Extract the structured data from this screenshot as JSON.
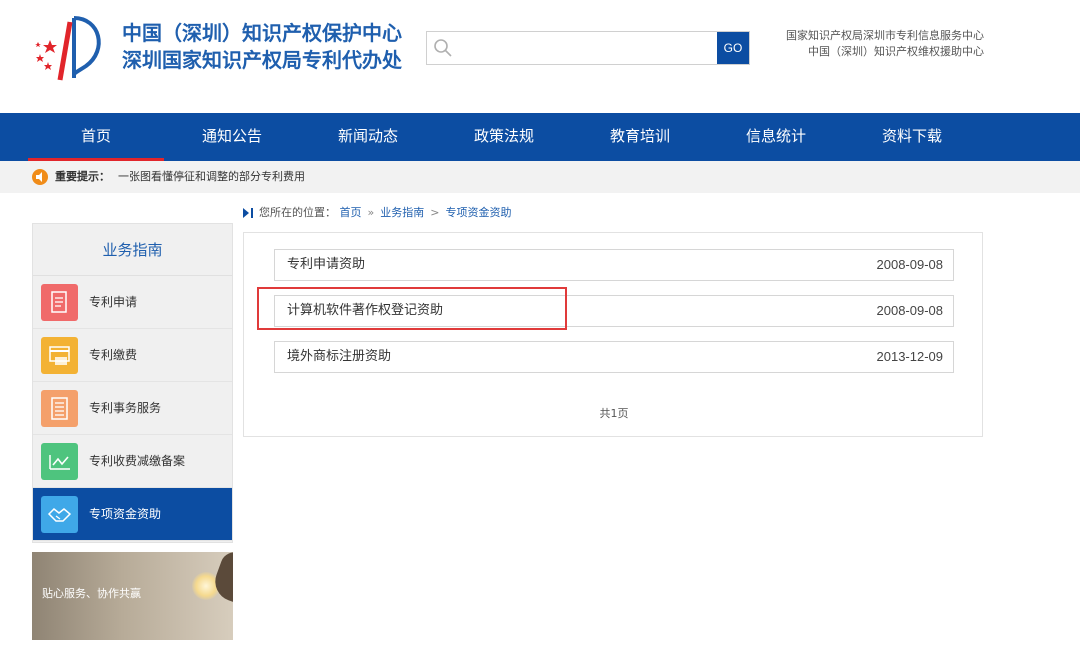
{
  "header": {
    "org_name_line1": "中国（深圳）知识产权保护中心",
    "org_name_line2": "深圳国家知识产权局专利代办处",
    "search": {
      "placeholder": "",
      "go_label": "GO"
    },
    "info_line1": "国家知识产权局深圳市专利信息服务中心",
    "info_line2": "中国（深圳）知识产权维权援助中心"
  },
  "nav": {
    "items": [
      {
        "label": "首页"
      },
      {
        "label": "通知公告"
      },
      {
        "label": "新闻动态"
      },
      {
        "label": "政策法规"
      },
      {
        "label": "教育培训"
      },
      {
        "label": "信息统计"
      },
      {
        "label": "资料下载"
      }
    ]
  },
  "notice": {
    "label": "重要提示：",
    "text": "一张图看懂停征和调整的部分专利费用"
  },
  "breadcrumb": {
    "prefix": "您所在的位置：",
    "items": [
      "首页",
      "业务指南",
      "专项资金资助"
    ],
    "sep1": "»",
    "sep2": ">"
  },
  "sidebar": {
    "title": "业务指南",
    "items": [
      {
        "label": "专利申请",
        "color": "#f06a6a"
      },
      {
        "label": "专利缴费",
        "color": "#f3b234"
      },
      {
        "label": "专利事务服务",
        "color": "#f4a06b"
      },
      {
        "label": "专利收费减缴备案",
        "color": "#4ec47e"
      },
      {
        "label": "专项资金资助",
        "color": "#3fa8e8"
      }
    ],
    "banner_text": "贴心服务、协作共赢"
  },
  "main": {
    "rows": [
      {
        "title": "专利申请资助",
        "date": "2008-09-08"
      },
      {
        "title": "计算机软件著作权登记资助",
        "date": "2008-09-08"
      },
      {
        "title": "境外商标注册资助",
        "date": "2013-12-09"
      }
    ],
    "pagination": "共1页"
  },
  "colors": {
    "brand_blue": "#0c4da2",
    "accent_red": "#e1252b",
    "highlight_red": "#e03a3a"
  }
}
